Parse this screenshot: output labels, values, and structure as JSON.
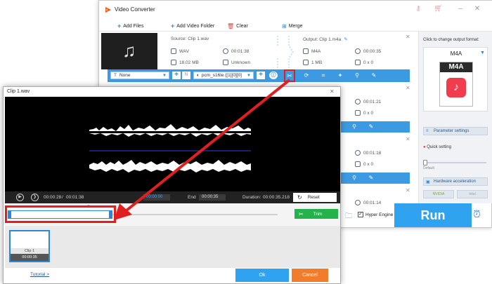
{
  "app": {
    "title": "Video Converter",
    "toolbar": {
      "add_files": "Add Files",
      "add_video_folder": "Add Video Folder",
      "clear": "Clear",
      "merge": "Merge"
    }
  },
  "file_item": {
    "source_label": "Source: Clip 1.wav",
    "source_format": "WAV",
    "source_duration": "00:01:38",
    "source_size": "18.02 MB",
    "source_resolution": "Unknown",
    "output_label": "Output: Clip 1.m4a",
    "output_format": "M4A",
    "output_duration": "00:00:35",
    "output_size": "1 MB",
    "output_resolution": "0 x 0"
  },
  "edit_bar": {
    "subtitle_value": "None",
    "audio_track_value": "pcm_s16le ([1][0][0]"
  },
  "other_items": [
    {
      "duration": "00:01:21",
      "resolution": "0 x 0"
    },
    {
      "duration": "00:01:18",
      "resolution": "0 x 0"
    },
    {
      "duration": "00:01:14",
      "resolution": ""
    }
  ],
  "right_panel": {
    "hint": "Click to change output format:",
    "format": "M4A",
    "icon_text": "M4A",
    "parameter_settings": "Parameter settings",
    "quick_setting": "Quick setting",
    "slider_label": "Default",
    "hardware_acceleration": "Hardware acceleration",
    "nvidia": "NVIDIA",
    "intel": "Intel"
  },
  "hyper_engine": "Hyper Engine",
  "run_label": "Run",
  "dialog": {
    "title": "Clip 1.wav",
    "current_time": "00:00:28",
    "separator": "/",
    "total_time": "00:01:38",
    "start_value": "00:00:00",
    "end_label": "End",
    "end_value": "00:00:35",
    "duration_label": "Duration:",
    "duration_value": "00:00:35.218",
    "reset_label": "Reset",
    "trim_label": "Trim",
    "clip_name": "Clip 1",
    "clip_duration": "00:00:35",
    "tutorial_link": "Tutorial >",
    "ok_label": "Ok",
    "cancel_label": "Cancel"
  },
  "colors": {
    "accent_blue": "#2fa3ef",
    "trim_green": "#24b24a",
    "cancel_orange": "#f07c2c",
    "highlight_red": "#e0201f"
  }
}
